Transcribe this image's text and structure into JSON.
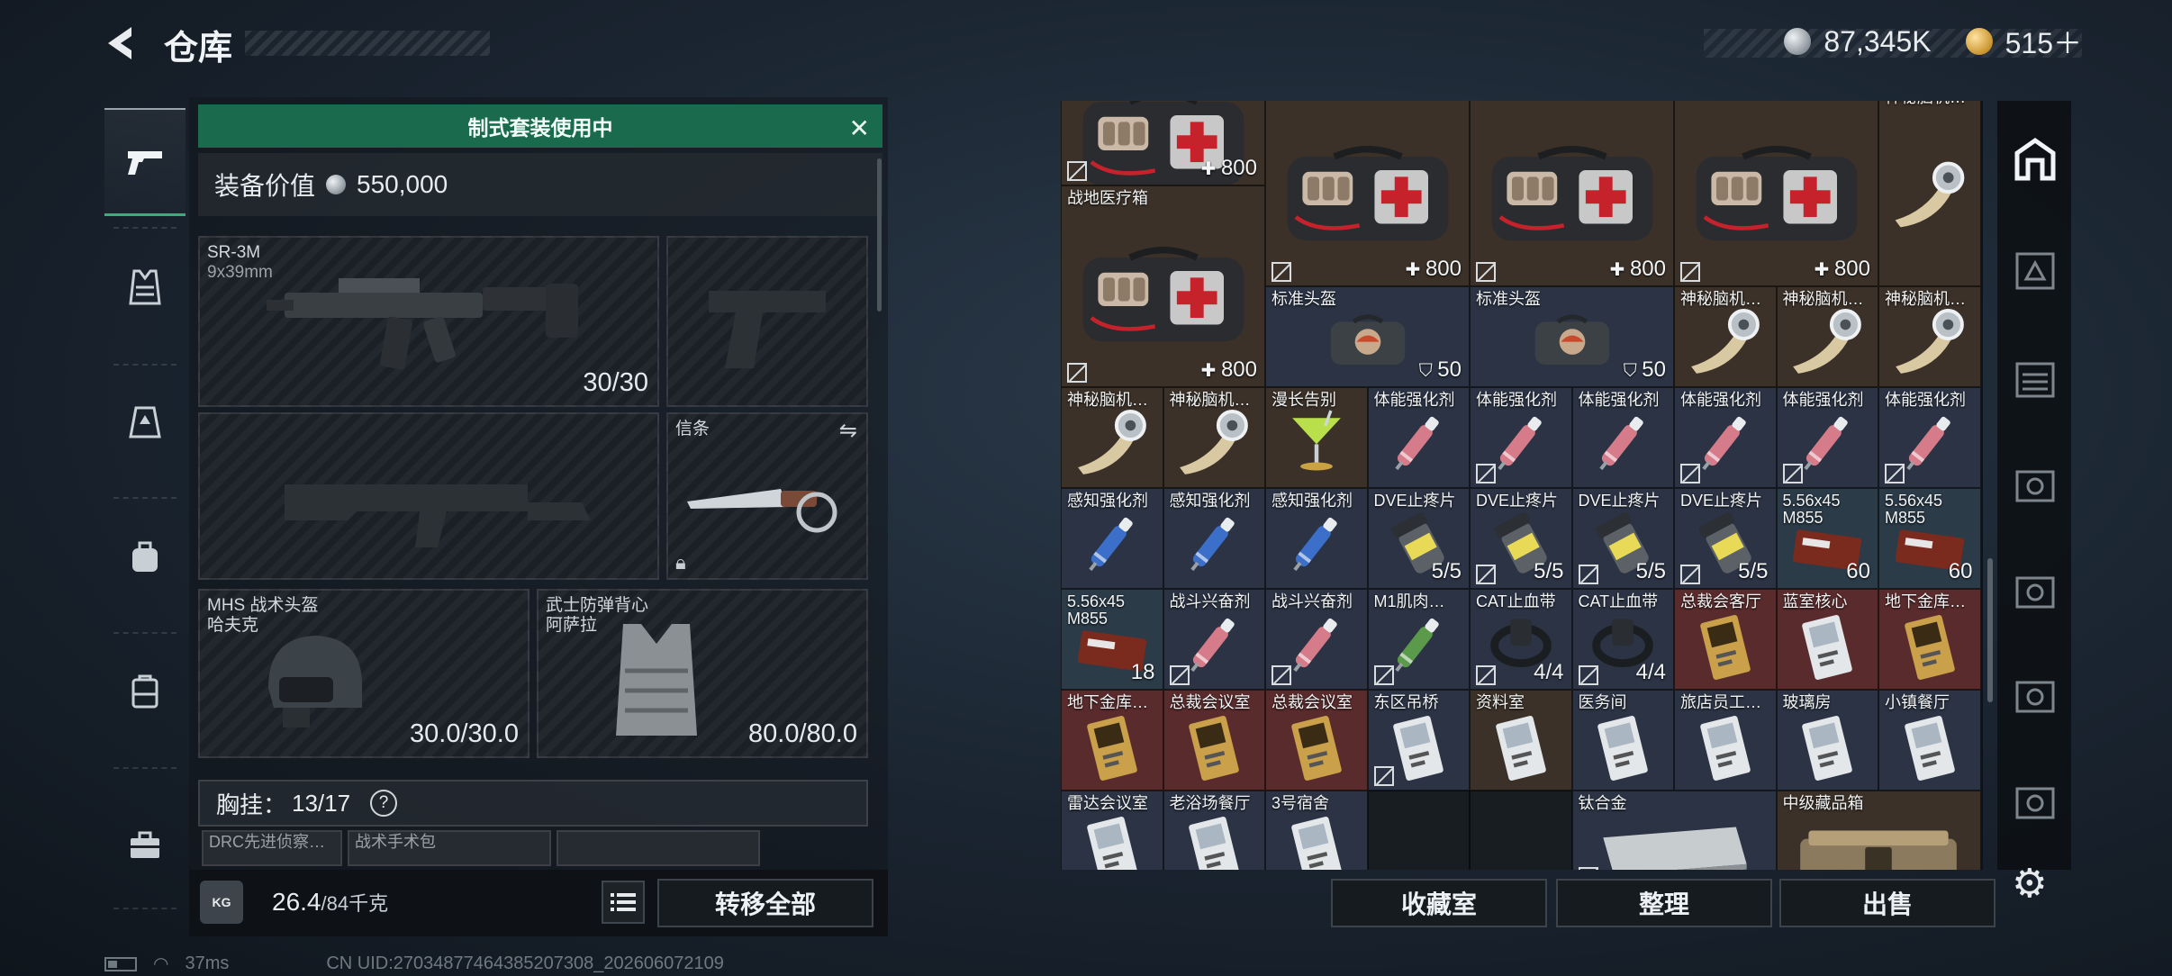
{
  "header": {
    "title": "仓库",
    "silver": "87,345K",
    "gold": "515＋"
  },
  "left": {
    "suit_banner": "制式套装使用中",
    "equip_value_label": "装备价值",
    "equip_value": "550,000",
    "primary_weapon": {
      "name": "SR-3M",
      "caliber": "9x39mm",
      "ammo": "30/30"
    },
    "melee": {
      "name": "信条"
    },
    "helmet": {
      "name": "MHS 战术头盔",
      "brand": "哈夫克",
      "durability": "30.0/30.0"
    },
    "vest": {
      "name": "武士防弹背心",
      "brand": "阿萨拉",
      "durability": "80.0/80.0"
    },
    "chest_rig_label": "胸挂：",
    "chest_rig_count": "13/17",
    "chest_help": "?",
    "chest_items": [
      "DRC先进侦察…",
      "战术手术包",
      ""
    ],
    "weight": "26.4",
    "weight_cap": "/84千克",
    "kg_badge": "KG",
    "transfer_all": "转移全部"
  },
  "inventory": {
    "cells": [
      {
        "label": "",
        "value": "800",
        "vtype": "plus",
        "color": "brown",
        "nosell": true,
        "art": "firstaid"
      },
      {
        "label": "",
        "value": "800",
        "vtype": "plus",
        "color": "brown",
        "nosell": true,
        "art": "firstaid"
      },
      {
        "label": "",
        "value": "800",
        "vtype": "plus",
        "color": "brown",
        "nosell": true,
        "art": "firstaid"
      },
      {
        "label": "",
        "value": "800",
        "vtype": "plus",
        "color": "brown",
        "nosell": true,
        "art": "firstaid"
      },
      {
        "label": "战地医疗箱",
        "value": "800",
        "vtype": "plus",
        "color": "brown",
        "nosell": true,
        "art": "firstaid"
      },
      {
        "label": "神秘脑机…",
        "value": "",
        "vtype": "",
        "color": "brown",
        "nosell": false,
        "art": "chip"
      },
      {
        "label": "标准头盔",
        "value": "50",
        "vtype": "shield",
        "color": "blue",
        "nosell": false,
        "art": "helmetbag"
      },
      {
        "label": "标准头盔",
        "value": "50",
        "vtype": "shield",
        "color": "blue",
        "nosell": false,
        "art": "helmetbag"
      },
      {
        "label": "神秘脑机…",
        "value": "",
        "vtype": "",
        "color": "brown",
        "nosell": false,
        "art": "chip"
      },
      {
        "label": "神秘脑机…",
        "value": "",
        "vtype": "",
        "color": "brown",
        "nosell": false,
        "art": "chip"
      },
      {
        "label": "神秘脑机…",
        "value": "",
        "vtype": "",
        "color": "brown",
        "nosell": false,
        "art": "chip"
      },
      {
        "label": "神秘脑机…",
        "value": "",
        "vtype": "",
        "color": "brown",
        "nosell": false,
        "art": "chip"
      },
      {
        "label": "神秘脑机…",
        "value": "",
        "vtype": "",
        "color": "brown",
        "nosell": false,
        "art": "chip"
      },
      {
        "label": "漫长告别",
        "value": "",
        "vtype": "",
        "color": "brown",
        "nosell": false,
        "art": "cocktail"
      },
      {
        "label": "体能强化剂",
        "value": "",
        "vtype": "",
        "color": "blue",
        "nosell": false,
        "art": "syringe-red"
      },
      {
        "label": "体能强化剂",
        "value": "",
        "vtype": "",
        "color": "blue",
        "nosell": true,
        "art": "syringe-red"
      },
      {
        "label": "体能强化剂",
        "value": "",
        "vtype": "",
        "color": "blue",
        "nosell": false,
        "art": "syringe-red"
      },
      {
        "label": "体能强化剂",
        "value": "",
        "vtype": "",
        "color": "blue",
        "nosell": true,
        "art": "syringe-red"
      },
      {
        "label": "体能强化剂",
        "value": "",
        "vtype": "",
        "color": "blue",
        "nosell": true,
        "art": "syringe-red"
      },
      {
        "label": "体能强化剂",
        "value": "",
        "vtype": "",
        "color": "blue",
        "nosell": true,
        "art": "syringe-red"
      },
      {
        "label": "感知强化剂",
        "value": "",
        "vtype": "",
        "color": "blue",
        "nosell": false,
        "art": "syringe-blue"
      },
      {
        "label": "感知强化剂",
        "value": "",
        "vtype": "",
        "color": "blue",
        "nosell": false,
        "art": "syringe-blue"
      },
      {
        "label": "感知强化剂",
        "value": "",
        "vtype": "",
        "color": "blue",
        "nosell": false,
        "art": "syringe-blue"
      },
      {
        "label": "DVE止疼片",
        "value": "5/5",
        "vtype": "",
        "color": "blue",
        "nosell": false,
        "art": "pills"
      },
      {
        "label": "DVE止疼片",
        "value": "5/5",
        "vtype": "",
        "color": "blue",
        "nosell": true,
        "art": "pills"
      },
      {
        "label": "DVE止疼片",
        "value": "5/5",
        "vtype": "",
        "color": "blue",
        "nosell": true,
        "art": "pills"
      },
      {
        "label": "DVE止疼片",
        "value": "5/5",
        "vtype": "",
        "color": "blue",
        "nosell": true,
        "art": "pills"
      },
      {
        "label": "5.56x45\nM855",
        "value": "60",
        "vtype": "",
        "color": "teal",
        "nosell": false,
        "art": "ammo"
      },
      {
        "label": "5.56x45\nM855",
        "value": "60",
        "vtype": "",
        "color": "teal",
        "nosell": false,
        "art": "ammo"
      },
      {
        "label": "5.56x45\nM855",
        "value": "18",
        "vtype": "",
        "color": "teal",
        "nosell": false,
        "art": "ammo"
      },
      {
        "label": "战斗兴奋剂",
        "value": "",
        "vtype": "",
        "color": "blue",
        "nosell": true,
        "art": "syringe-red"
      },
      {
        "label": "战斗兴奋剂",
        "value": "",
        "vtype": "",
        "color": "blue",
        "nosell": true,
        "art": "syringe-red"
      },
      {
        "label": "M1肌肉…",
        "value": "",
        "vtype": "",
        "color": "blue",
        "nosell": true,
        "art": "syringe-green"
      },
      {
        "label": "CAT止血带",
        "value": "4/4",
        "vtype": "",
        "color": "blue",
        "nosell": true,
        "art": "tourniquet"
      },
      {
        "label": "CAT止血带",
        "value": "4/4",
        "vtype": "",
        "color": "blue",
        "nosell": true,
        "art": "tourniquet"
      },
      {
        "label": "总裁会客厅",
        "value": "",
        "vtype": "",
        "color": "red",
        "nosell": false,
        "art": "card-gold"
      },
      {
        "label": "蓝室核心",
        "value": "",
        "vtype": "",
        "color": "red",
        "nosell": false,
        "art": "card"
      },
      {
        "label": "地下金库…",
        "value": "",
        "vtype": "",
        "color": "red",
        "nosell": false,
        "art": "card-gold"
      },
      {
        "label": "地下金库…",
        "value": "",
        "vtype": "",
        "color": "red",
        "nosell": false,
        "art": "card-gold"
      },
      {
        "label": "总裁会议室",
        "value": "",
        "vtype": "",
        "color": "red",
        "nosell": false,
        "art": "card-gold"
      },
      {
        "label": "总裁会议室",
        "value": "",
        "vtype": "",
        "color": "red",
        "nosell": false,
        "art": "card-gold"
      },
      {
        "label": "东区吊桥",
        "value": "",
        "vtype": "",
        "color": "blue",
        "nosell": true,
        "art": "card"
      },
      {
        "label": "资料室",
        "value": "",
        "vtype": "",
        "color": "brown",
        "nosell": false,
        "art": "card"
      },
      {
        "label": "医务间",
        "value": "",
        "vtype": "",
        "color": "blue",
        "nosell": false,
        "art": "card"
      },
      {
        "label": "旅店员工…",
        "value": "",
        "vtype": "",
        "color": "blue",
        "nosell": false,
        "art": "card"
      },
      {
        "label": "玻璃房",
        "value": "",
        "vtype": "",
        "color": "blue",
        "nosell": false,
        "art": "card"
      },
      {
        "label": "小镇餐厅",
        "value": "",
        "vtype": "",
        "color": "blue",
        "nosell": false,
        "art": "card"
      },
      {
        "label": "雷达会议室",
        "value": "",
        "vtype": "",
        "color": "blue",
        "nosell": false,
        "art": "card"
      },
      {
        "label": "老浴场餐厅",
        "value": "",
        "vtype": "",
        "color": "blue",
        "nosell": false,
        "art": "card"
      },
      {
        "label": "3号宿舍",
        "value": "",
        "vtype": "",
        "color": "blue",
        "nosell": false,
        "art": "card"
      },
      {
        "label": "",
        "value": "",
        "vtype": "",
        "color": "empty",
        "nosell": false,
        "art": ""
      },
      {
        "label": "",
        "value": "",
        "vtype": "",
        "color": "empty",
        "nosell": false,
        "art": ""
      },
      {
        "label": "钛合金",
        "value": "",
        "vtype": "",
        "color": "blue",
        "nosell": true,
        "art": "metal"
      },
      {
        "label": "中级藏品箱",
        "value": "",
        "vtype": "",
        "color": "brown",
        "nosell": false,
        "art": "crate"
      }
    ],
    "btn_collection": "收藏室",
    "btn_sort": "整理",
    "btn_sell": "出售"
  },
  "status": {
    "ping": "37ms",
    "uid": "CN UID:270348774643852073​08_202606072109"
  }
}
